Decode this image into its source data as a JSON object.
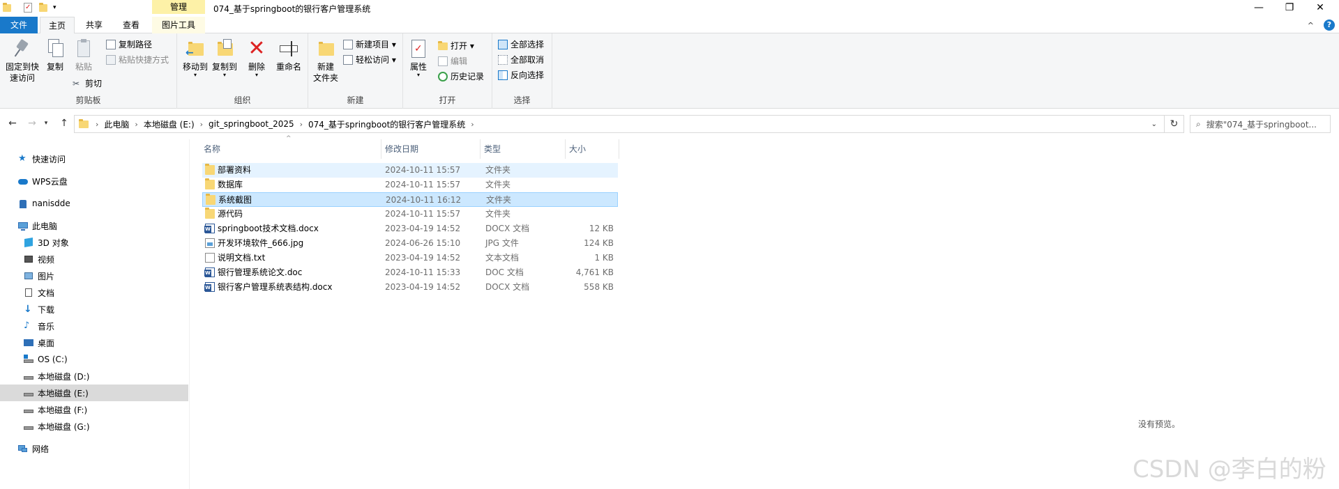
{
  "window": {
    "title": "074_基于springboot的银行客户管理系统",
    "context_tab": "管理",
    "controls": {
      "minimize": "—",
      "maximize": "❐",
      "close": "✕"
    }
  },
  "tabs": {
    "file": "文件",
    "home": "主页",
    "share": "共享",
    "view": "查看",
    "picture_tools": "图片工具",
    "help": "?",
    "collapse": "^"
  },
  "ribbon": {
    "clipboard": {
      "label": "剪贴板",
      "pin": "固定到快\n速访问",
      "copy": "复制",
      "paste": "粘贴",
      "copy_path": "复制路径",
      "paste_shortcut": "粘贴快捷方式",
      "cut": "剪切"
    },
    "organize": {
      "label": "组织",
      "move_to": "移动到",
      "copy_to": "复制到",
      "delete": "删除",
      "rename": "重命名"
    },
    "new": {
      "label": "新建",
      "new_folder": "新建\n文件夹",
      "new_item": "新建项目 ▾",
      "easy_access": "轻松访问 ▾"
    },
    "open": {
      "label": "打开",
      "properties": "属性",
      "open": "打开 ▾",
      "edit": "编辑",
      "history": "历史记录"
    },
    "select": {
      "label": "选择",
      "select_all": "全部选择",
      "select_none": "全部取消",
      "invert": "反向选择"
    }
  },
  "address": {
    "breadcrumbs": [
      "此电脑",
      "本地磁盘 (E:)",
      "git_springboot_2025",
      "074_基于springboot的银行客户管理系统"
    ],
    "search_placeholder": "搜索\"074_基于springboot..."
  },
  "nav": {
    "items": [
      {
        "label": "快速访问",
        "icon": "star-icon"
      },
      {
        "label": "WPS云盘",
        "icon": "cloud-icon"
      },
      {
        "label": "nanisdde",
        "icon": "user-folder-icon"
      },
      {
        "label": "此电脑",
        "icon": "pc-icon"
      },
      {
        "label": "3D 对象",
        "icon": "3d-icon"
      },
      {
        "label": "视频",
        "icon": "video-icon"
      },
      {
        "label": "图片",
        "icon": "picture-icon"
      },
      {
        "label": "文档",
        "icon": "document-icon"
      },
      {
        "label": "下载",
        "icon": "download-icon"
      },
      {
        "label": "音乐",
        "icon": "music-icon"
      },
      {
        "label": "桌面",
        "icon": "desktop-icon"
      },
      {
        "label": "OS (C:)",
        "icon": "os-drive-icon"
      },
      {
        "label": "本地磁盘 (D:)",
        "icon": "drive-icon"
      },
      {
        "label": "本地磁盘 (E:)",
        "icon": "drive-icon"
      },
      {
        "label": "本地磁盘 (F:)",
        "icon": "drive-icon"
      },
      {
        "label": "本地磁盘 (G:)",
        "icon": "drive-icon"
      },
      {
        "label": "网络",
        "icon": "network-icon"
      }
    ]
  },
  "list": {
    "columns": {
      "name": "名称",
      "date": "修改日期",
      "type": "类型",
      "size": "大小"
    },
    "files": [
      {
        "name": "部署资料",
        "date": "2024-10-11 15:57",
        "type": "文件夹",
        "size": "",
        "icon": "folder-icon"
      },
      {
        "name": "数据库",
        "date": "2024-10-11 15:57",
        "type": "文件夹",
        "size": "",
        "icon": "folder-icon"
      },
      {
        "name": "系统截图",
        "date": "2024-10-11 16:12",
        "type": "文件夹",
        "size": "",
        "icon": "folder-icon"
      },
      {
        "name": "源代码",
        "date": "2024-10-11 15:57",
        "type": "文件夹",
        "size": "",
        "icon": "folder-icon"
      },
      {
        "name": "springboot技术文档.docx",
        "date": "2023-04-19 14:52",
        "type": "DOCX 文档",
        "size": "12 KB",
        "icon": "word-doc-icon"
      },
      {
        "name": "开发环境软件_666.jpg",
        "date": "2024-06-26 15:10",
        "type": "JPG 文件",
        "size": "124 KB",
        "icon": "image-file-icon"
      },
      {
        "name": "说明文档.txt",
        "date": "2023-04-19 14:52",
        "type": "文本文档",
        "size": "1 KB",
        "icon": "text-file-icon"
      },
      {
        "name": "银行管理系统论文.doc",
        "date": "2024-10-11 15:33",
        "type": "DOC 文档",
        "size": "4,761 KB",
        "icon": "word-doc-icon"
      },
      {
        "name": "银行客户管理系统表结构.docx",
        "date": "2023-04-19 14:52",
        "type": "DOCX 文档",
        "size": "558 KB",
        "icon": "word-doc-icon"
      }
    ]
  },
  "preview": {
    "empty_text": "没有预览。"
  },
  "watermark": "CSDN @李白的粉",
  "colors": {
    "accent": "#1979ca",
    "context_tab": "#fdf1a7",
    "selection": "#cce8ff",
    "hover": "#e5f3ff"
  }
}
